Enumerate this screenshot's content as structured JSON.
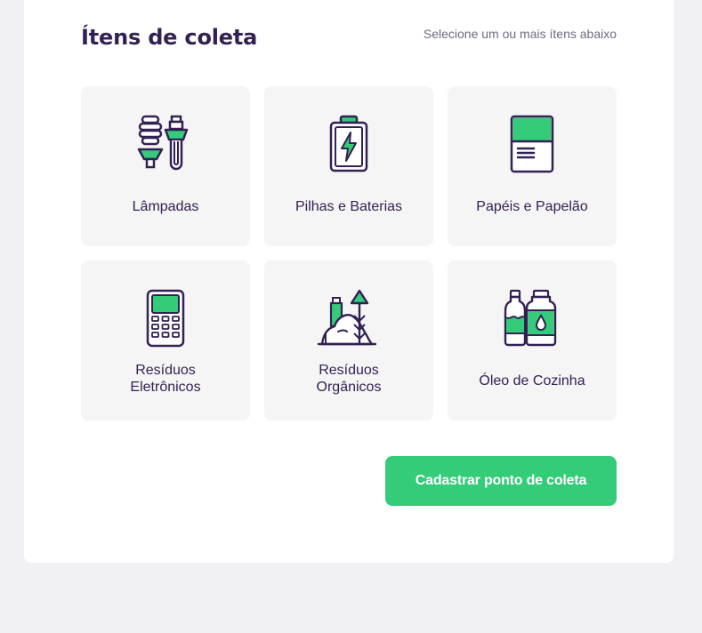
{
  "colors": {
    "page_background": "#F0F0F5",
    "card_background": "#FFFFFF",
    "item_background": "#F5F5F5",
    "primary_text": "#322153",
    "secondary_text": "#6C6C80",
    "accent_green": "#34CB79",
    "button_text": "#FFFFFF"
  },
  "section": {
    "title": "Ítens de coleta",
    "hint": "Selecione um ou mais ítens abaixo"
  },
  "items": [
    {
      "label": "Lâmpadas",
      "icon": "lamp-bulbs-icon"
    },
    {
      "label": "Pilhas e Baterias",
      "icon": "battery-icon"
    },
    {
      "label": "Papéis e Papelão",
      "icon": "paper-cardboard-icon"
    },
    {
      "label": "Resíduos Eletrônicos",
      "icon": "electronic-device-icon"
    },
    {
      "label": "Resíduos Orgânicos",
      "icon": "organic-waste-icon"
    },
    {
      "label": "Óleo de Cozinha",
      "icon": "cooking-oil-bottles-icon"
    }
  ],
  "submit": {
    "label": "Cadastrar ponto de coleta"
  }
}
